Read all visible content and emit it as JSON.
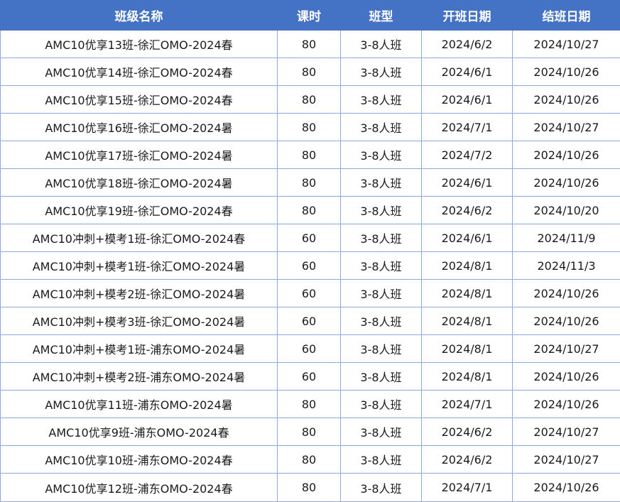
{
  "table": {
    "header_color": "#4472c4",
    "headers": [
      "班级名称",
      "课时",
      "班型",
      "开班日期",
      "结班日期"
    ],
    "rows": [
      [
        "AMC10优享13班-徐汇OMO-2024春",
        "80",
        "3-8人班",
        "2024/6/2",
        "2024/10/27"
      ],
      [
        "AMC10优享14班-徐汇OMO-2024春",
        "80",
        "3-8人班",
        "2024/6/1",
        "2024/10/26"
      ],
      [
        "AMC10优享15班-徐汇OMO-2024春",
        "80",
        "3-8人班",
        "2024/6/1",
        "2024/10/26"
      ],
      [
        "AMC10优享16班-徐汇OMO-2024暑",
        "80",
        "3-8人班",
        "2024/7/1",
        "2024/10/27"
      ],
      [
        "AMC10优享17班-徐汇OMO-2024暑",
        "80",
        "3-8人班",
        "2024/7/2",
        "2024/10/26"
      ],
      [
        "AMC10优享18班-徐汇OMO-2024暑",
        "80",
        "3-8人班",
        "2024/6/1",
        "2024/10/26"
      ],
      [
        "AMC10优享19班-徐汇OMO-2024春",
        "80",
        "3-8人班",
        "2024/6/2",
        "2024/10/20"
      ],
      [
        "AMC10冲刺+模考1班-徐汇OMO-2024春",
        "60",
        "3-8人班",
        "2024/6/1",
        "2024/11/9"
      ],
      [
        "AMC10冲刺+模考1班-徐汇OMO-2024暑",
        "60",
        "3-8人班",
        "2024/8/1",
        "2024/11/3"
      ],
      [
        "AMC10冲刺+模考2班-徐汇OMO-2024暑",
        "60",
        "3-8人班",
        "2024/8/1",
        "2024/10/26"
      ],
      [
        "AMC10冲刺+模考3班-徐汇OMO-2024暑",
        "60",
        "3-8人班",
        "2024/8/1",
        "2024/10/26"
      ],
      [
        "AMC10冲刺+模考1班-浦东OMO-2024暑",
        "60",
        "3-8人班",
        "2024/8/1",
        "2024/10/27"
      ],
      [
        "AMC10冲刺+模考2班-浦东OMO-2024暑",
        "60",
        "3-8人班",
        "2024/8/1",
        "2024/10/26"
      ],
      [
        "AMC10优享11班-浦东OMO-2024暑",
        "80",
        "3-8人班",
        "2024/7/1",
        "2024/10/26"
      ],
      [
        "AMC10优享9班-浦东OMO-2024春",
        "80",
        "3-8人班",
        "2024/6/2",
        "2024/10/27"
      ],
      [
        "AMC10优享10班-浦东OMO-2024春",
        "80",
        "3-8人班",
        "2024/6/2",
        "2024/10/27"
      ],
      [
        "AMC10优享12班-浦东OMO-2024春",
        "80",
        "3-8人班",
        "2024/7/1",
        "2024/10/26"
      ]
    ]
  }
}
